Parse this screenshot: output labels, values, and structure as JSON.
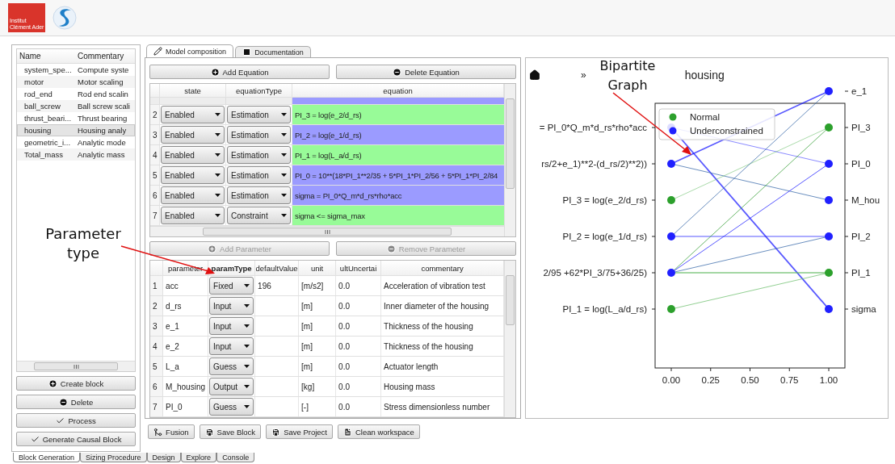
{
  "logo": {
    "lines": [
      "Institut",
      "Clément Ader"
    ]
  },
  "block_list": {
    "columns": [
      "Name",
      "Commentary"
    ],
    "items": [
      {
        "name": "system_spe...",
        "commentary": "Compute syste",
        "selected": false
      },
      {
        "name": "motor",
        "commentary": "Motor scaling",
        "selected": false
      },
      {
        "name": "rod_end",
        "commentary": "Rod end scalin",
        "selected": false
      },
      {
        "name": "ball_screw",
        "commentary": "Ball screw scali",
        "selected": false
      },
      {
        "name": "thrust_beari...",
        "commentary": "Thrust bearing",
        "selected": false
      },
      {
        "name": "housing",
        "commentary": "Housing analy",
        "selected": true
      },
      {
        "name": "geometric_i...",
        "commentary": "Analytic mode",
        "selected": false
      },
      {
        "name": "Total_mass",
        "commentary": "Analytic mass",
        "selected": false
      }
    ]
  },
  "block_buttons": [
    {
      "label": "Create block",
      "kind": "plus"
    },
    {
      "label": "Delete",
      "kind": "minus"
    },
    {
      "label": "Process",
      "kind": "check"
    },
    {
      "label": "Generate Causal Block",
      "kind": "check"
    }
  ],
  "tabs": [
    {
      "label": "Model composition",
      "kind": "pencil",
      "selected": true
    },
    {
      "label": "Documentation",
      "kind": "square",
      "selected": false
    }
  ],
  "equation_buttons": [
    {
      "label": "Add Equation",
      "kind": "plus",
      "disabled": false
    },
    {
      "label": "Delete Equation",
      "kind": "minus",
      "disabled": false
    }
  ],
  "equations": {
    "columns": [
      "state",
      "equationType",
      "equation"
    ],
    "partial_row": {
      "color": "#9b9bff"
    },
    "rows": [
      {
        "number": "2",
        "state": "Enabled",
        "type": "Estimation",
        "equation": "PI_3 = log(e_2/d_rs)",
        "color": "#98fb98"
      },
      {
        "number": "3",
        "state": "Enabled",
        "type": "Estimation",
        "equation": "PI_2 = log(e_1/d_rs)",
        "color": "#9b9bff"
      },
      {
        "number": "4",
        "state": "Enabled",
        "type": "Estimation",
        "equation": "PI_1 = log(L_a/d_rs)",
        "color": "#98fb98"
      },
      {
        "number": "5",
        "state": "Enabled",
        "type": "Estimation",
        "equation": "PI_0 = 10**(18*PI_1**2/35 + 5*PI_1*PI_2/56 + 5*PI_1*PI_2/84",
        "color": "#9b9bff"
      },
      {
        "number": "6",
        "state": "Enabled",
        "type": "Estimation",
        "equation": "sigma = PI_0*Q_m*d_rs*rho*acc",
        "color": "#9b9bff"
      },
      {
        "number": "7",
        "state": "Enabled",
        "type": "Constraint",
        "equation": "sigma <= sigma_max",
        "color": "#98fb98"
      }
    ]
  },
  "parameter_buttons": [
    {
      "label": "Add Parameter",
      "kind": "plus",
      "disabled": true
    },
    {
      "label": "Remove Parameter",
      "kind": "minus",
      "disabled": true
    }
  ],
  "parameters": {
    "columns": [
      {
        "label": "parameter",
        "selected": false
      },
      {
        "label": "paramType",
        "selected": true
      },
      {
        "label": "defaultValue",
        "selected": false
      },
      {
        "label": "unit",
        "selected": false
      },
      {
        "label": "ultUncertai",
        "selected": false
      },
      {
        "label": "commentary",
        "selected": false
      }
    ],
    "rows": [
      {
        "number": "1",
        "parameter": "acc",
        "param_type": "Fixed",
        "default_value": "196",
        "unit": "[m/s2]",
        "uncertainty": "0.0",
        "commentary": "Acceleration of vibration test"
      },
      {
        "number": "2",
        "parameter": "d_rs",
        "param_type": "Input",
        "unit": "[m]",
        "uncertainty": "0.0",
        "commentary": "Inner diameter of the housing"
      },
      {
        "number": "3",
        "parameter": "e_1",
        "param_type": "Input",
        "unit": "[m]",
        "uncertainty": "0.0",
        "commentary": "Thickness of the housing"
      },
      {
        "number": "4",
        "parameter": "e_2",
        "param_type": "Input",
        "unit": "[m]",
        "uncertainty": "0.0",
        "commentary": "Thickness of the housing"
      },
      {
        "number": "5",
        "parameter": "L_a",
        "param_type": "Guess",
        "unit": "[m]",
        "uncertainty": "0.0",
        "commentary": "Actuator length"
      },
      {
        "number": "6",
        "parameter": "M_housing",
        "param_type": "Output",
        "unit": "[kg]",
        "uncertainty": "0.0",
        "commentary": "Housing mass"
      },
      {
        "number": "7",
        "parameter": "PI_0",
        "param_type": "Guess",
        "unit": "[-]",
        "uncertainty": "0.0",
        "commentary": "Stress dimensionless number"
      }
    ]
  },
  "action_buttons": [
    {
      "label": "Fusion",
      "kind": "merge"
    },
    {
      "label": "Save Block",
      "kind": "save"
    },
    {
      "label": "Save Project",
      "kind": "save"
    },
    {
      "label": "Clean workspace",
      "kind": "file"
    }
  ],
  "graph": {
    "nav": "»",
    "title": "housing",
    "legend": [
      {
        "label": "Normal",
        "color": "#2ca02c"
      },
      {
        "label": "Underconstrained",
        "color": "#2020ff"
      }
    ],
    "left_nodes": [
      {
        "label": "= PI_0*Q_m*d_rs*rho*acc",
        "color": "#2020ff"
      },
      {
        "label": "rs/2+e_1)**2-(d_rs/2)**2))",
        "color": "#2020ff"
      },
      {
        "label": "PI_3 = log(e_2/d_rs)",
        "color": "#2ca02c"
      },
      {
        "label": "PI_2 = log(e_1/d_rs)",
        "color": "#2020ff"
      },
      {
        "label": "2/95 +62*PI_3/75+36/25)",
        "color": "#2020ff"
      },
      {
        "label": "PI_1 = log(L_a/d_rs)",
        "color": "#2ca02c"
      }
    ],
    "right_nodes": [
      {
        "label": "e_1",
        "color": "#2020ff"
      },
      {
        "label": "PI_3",
        "color": "#2ca02c"
      },
      {
        "label": "PI_0",
        "color": "#2020ff"
      },
      {
        "label": "M_hou",
        "color": "#2020ff"
      },
      {
        "label": "PI_2",
        "color": "#2020ff"
      },
      {
        "label": "PI_1",
        "color": "#2ca02c"
      },
      {
        "label": "sigma",
        "color": "#2020ff"
      }
    ],
    "xticks": [
      "0.00",
      "0.25",
      "0.50",
      "0.75",
      "1.00"
    ]
  },
  "annotations": [
    {
      "text": "Parameter type"
    },
    {
      "text": "Bipartite Graph"
    }
  ],
  "bottom_tabs": [
    {
      "label": "Block Generation",
      "selected": true
    },
    {
      "label": "Sizing Procedure",
      "selected": false
    },
    {
      "label": "Design",
      "selected": false
    },
    {
      "label": "Explore",
      "selected": false
    },
    {
      "label": "Console",
      "selected": false
    }
  ]
}
